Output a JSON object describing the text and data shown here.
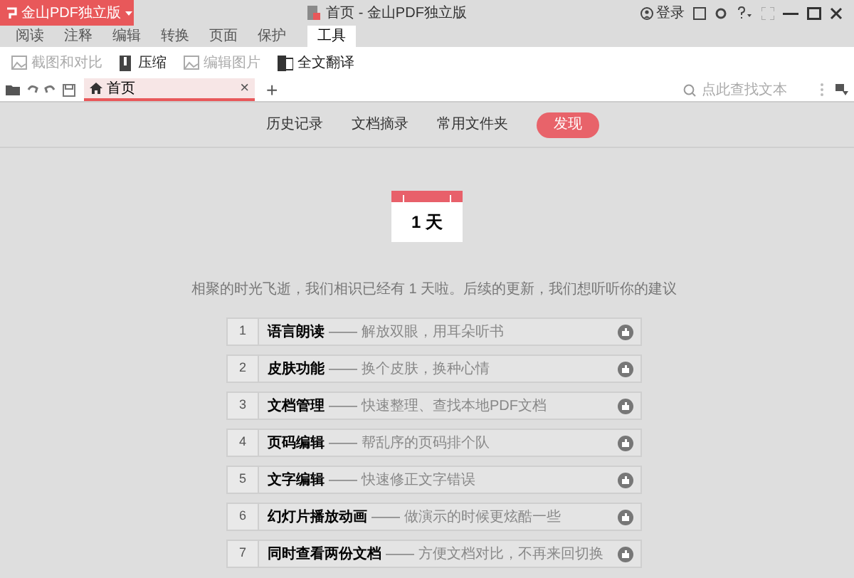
{
  "app_button": {
    "label": "金山PDF独立版"
  },
  "window": {
    "title": "首页 - 金山PDF独立版",
    "login": "登录"
  },
  "ribbon_tabs": [
    {
      "label": "阅读",
      "selected": false
    },
    {
      "label": "注释",
      "selected": false
    },
    {
      "label": "编辑",
      "selected": false
    },
    {
      "label": "转换",
      "selected": false
    },
    {
      "label": "页面",
      "selected": false
    },
    {
      "label": "保护",
      "selected": false
    },
    {
      "label": "工具",
      "selected": true
    }
  ],
  "tools": [
    {
      "label": "截图和对比",
      "disabled": true
    },
    {
      "label": "压缩",
      "disabled": false
    },
    {
      "label": "编辑图片",
      "disabled": true
    },
    {
      "label": "全文翻译",
      "disabled": false
    }
  ],
  "doc_tabs": [
    {
      "label": "首页",
      "selected": true,
      "close": "×"
    }
  ],
  "new_tab": "+",
  "search": {
    "placeholder": "点此查找文本"
  },
  "nav": [
    {
      "label": "历史记录",
      "selected": false
    },
    {
      "label": "文档摘录",
      "selected": false
    },
    {
      "label": "常用文件夹",
      "selected": false
    },
    {
      "label": "发现",
      "selected": true
    }
  ],
  "calendar": {
    "text": "1 天"
  },
  "message": "相聚的时光飞逝，我们相识已经有 1 天啦。后续的更新，我们想听听你的建议",
  "features": [
    {
      "number": "1",
      "title": "语言朗读",
      "dash": "——",
      "description": "解放双眼，用耳朵听书"
    },
    {
      "number": "2",
      "title": "皮肤功能",
      "dash": "——",
      "description": "换个皮肤，换种心情"
    },
    {
      "number": "3",
      "title": "文档管理",
      "dash": "——",
      "description": "快速整理、查找本地PDF文档"
    },
    {
      "number": "4",
      "title": "页码编辑",
      "dash": "——",
      "description": "帮乱序的页码排个队"
    },
    {
      "number": "5",
      "title": "文字编辑",
      "dash": "——",
      "description": "快速修正文字错误"
    },
    {
      "number": "6",
      "title": "幻灯片播放动画",
      "dash": "——",
      "description": "做演示的时候更炫酷一些"
    },
    {
      "number": "7",
      "title": "同时查看两份文档",
      "dash": "——",
      "description": "方便文档对比，不再来回切换"
    }
  ]
}
